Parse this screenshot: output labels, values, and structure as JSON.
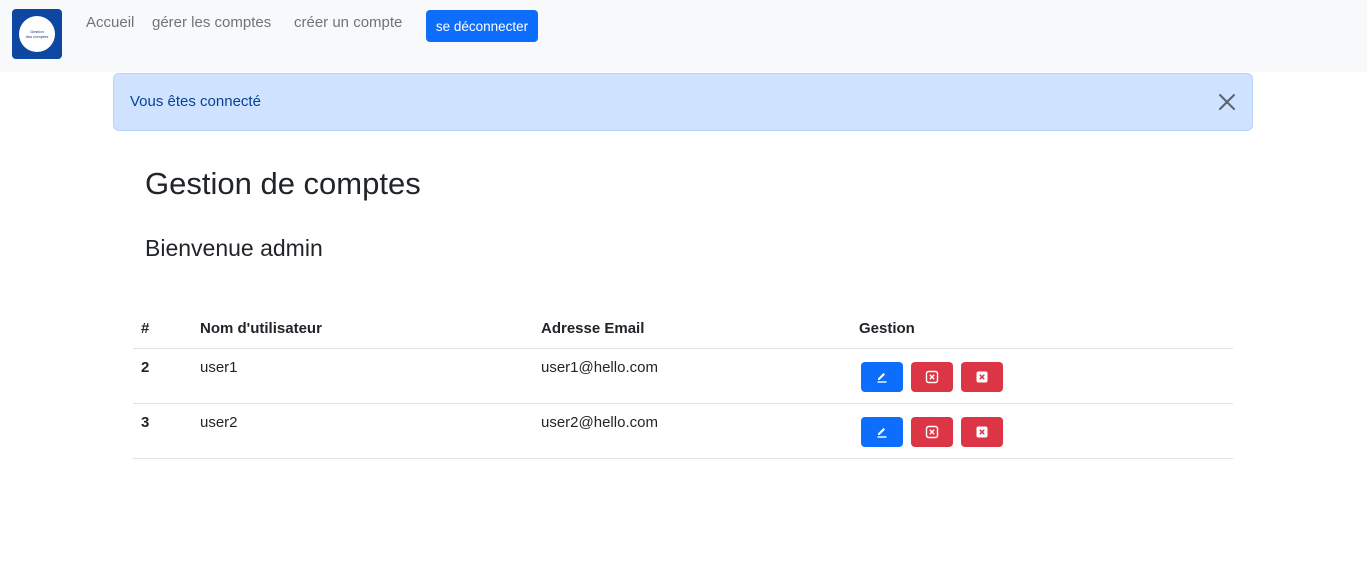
{
  "nav": {
    "logo_line1": "Gestion",
    "logo_line2": "des comptes",
    "links": [
      "Accueil",
      "gérer les comptes",
      "créer un compte"
    ],
    "logout_label": "se déconnecter"
  },
  "alert": {
    "message": "Vous êtes connecté",
    "close_icon": "close-icon"
  },
  "main": {
    "title": "Gestion de comptes",
    "subtitle": "Bienvenue admin"
  },
  "table": {
    "headers": [
      "#",
      "Nom d'utilisateur",
      "Adresse Email",
      "Gestion"
    ],
    "rows": [
      {
        "id": "2",
        "username": "user1",
        "email": "user1@hello.com"
      },
      {
        "id": "3",
        "username": "user2",
        "email": "user2@hello.com"
      }
    ]
  },
  "colors": {
    "primary": "#0d6efd",
    "danger": "#dc3545",
    "alert_bg": "#cfe2ff",
    "alert_text": "#084298",
    "logo_bg": "#0d47a1"
  }
}
